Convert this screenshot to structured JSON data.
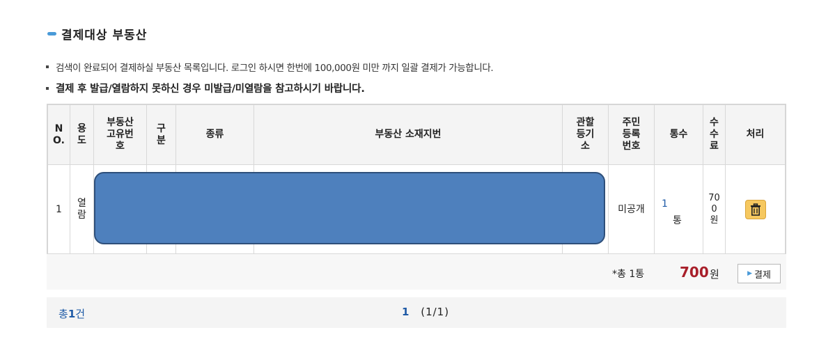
{
  "section": {
    "title": "결제대상 부동산"
  },
  "notes": {
    "line1": "검색이 완료되어 결제하실 부동산 목록입니다. 로그인 하시면 한번에 100,000원 미만 까지 일괄 결제가 가능합니다.",
    "line2": "결제 후 발급/열람하지 못하신 경우 미발급/미열람을 참고하시기 바랍니다."
  },
  "table": {
    "headers": {
      "no": "N\nO.",
      "use": "용\n도",
      "unique_id": "부동산\n고유번\n호",
      "division": "구\n분",
      "kind": "종류",
      "address": "부동산 소재지번",
      "office": "관할\n등기\n소",
      "rrn": "주민\n등록\n번호",
      "count": "통수",
      "fee": "수\n수\n료",
      "action": "처리"
    },
    "rows": [
      {
        "no": "1",
        "use": "열\n람",
        "rrn": "미공개",
        "count": "1",
        "count_unit": "통",
        "fee": "70\n0\n원"
      }
    ]
  },
  "summary": {
    "label": "*총 1통",
    "amount": "700",
    "unit": "원",
    "pay_label": "결제"
  },
  "pager": {
    "total_prefix": "총",
    "total_count": "1",
    "total_suffix": "건",
    "current": "1",
    "range": "(1/1)"
  },
  "colors": {
    "accent": "#4a9ad8",
    "link": "#1e5aa6",
    "amount": "#a81f2a",
    "redaction": "#4e80bd",
    "trash_button": "#f6c860"
  },
  "icons": {
    "delete": "trash-icon",
    "pay_arrow": "arrow-right-icon"
  }
}
